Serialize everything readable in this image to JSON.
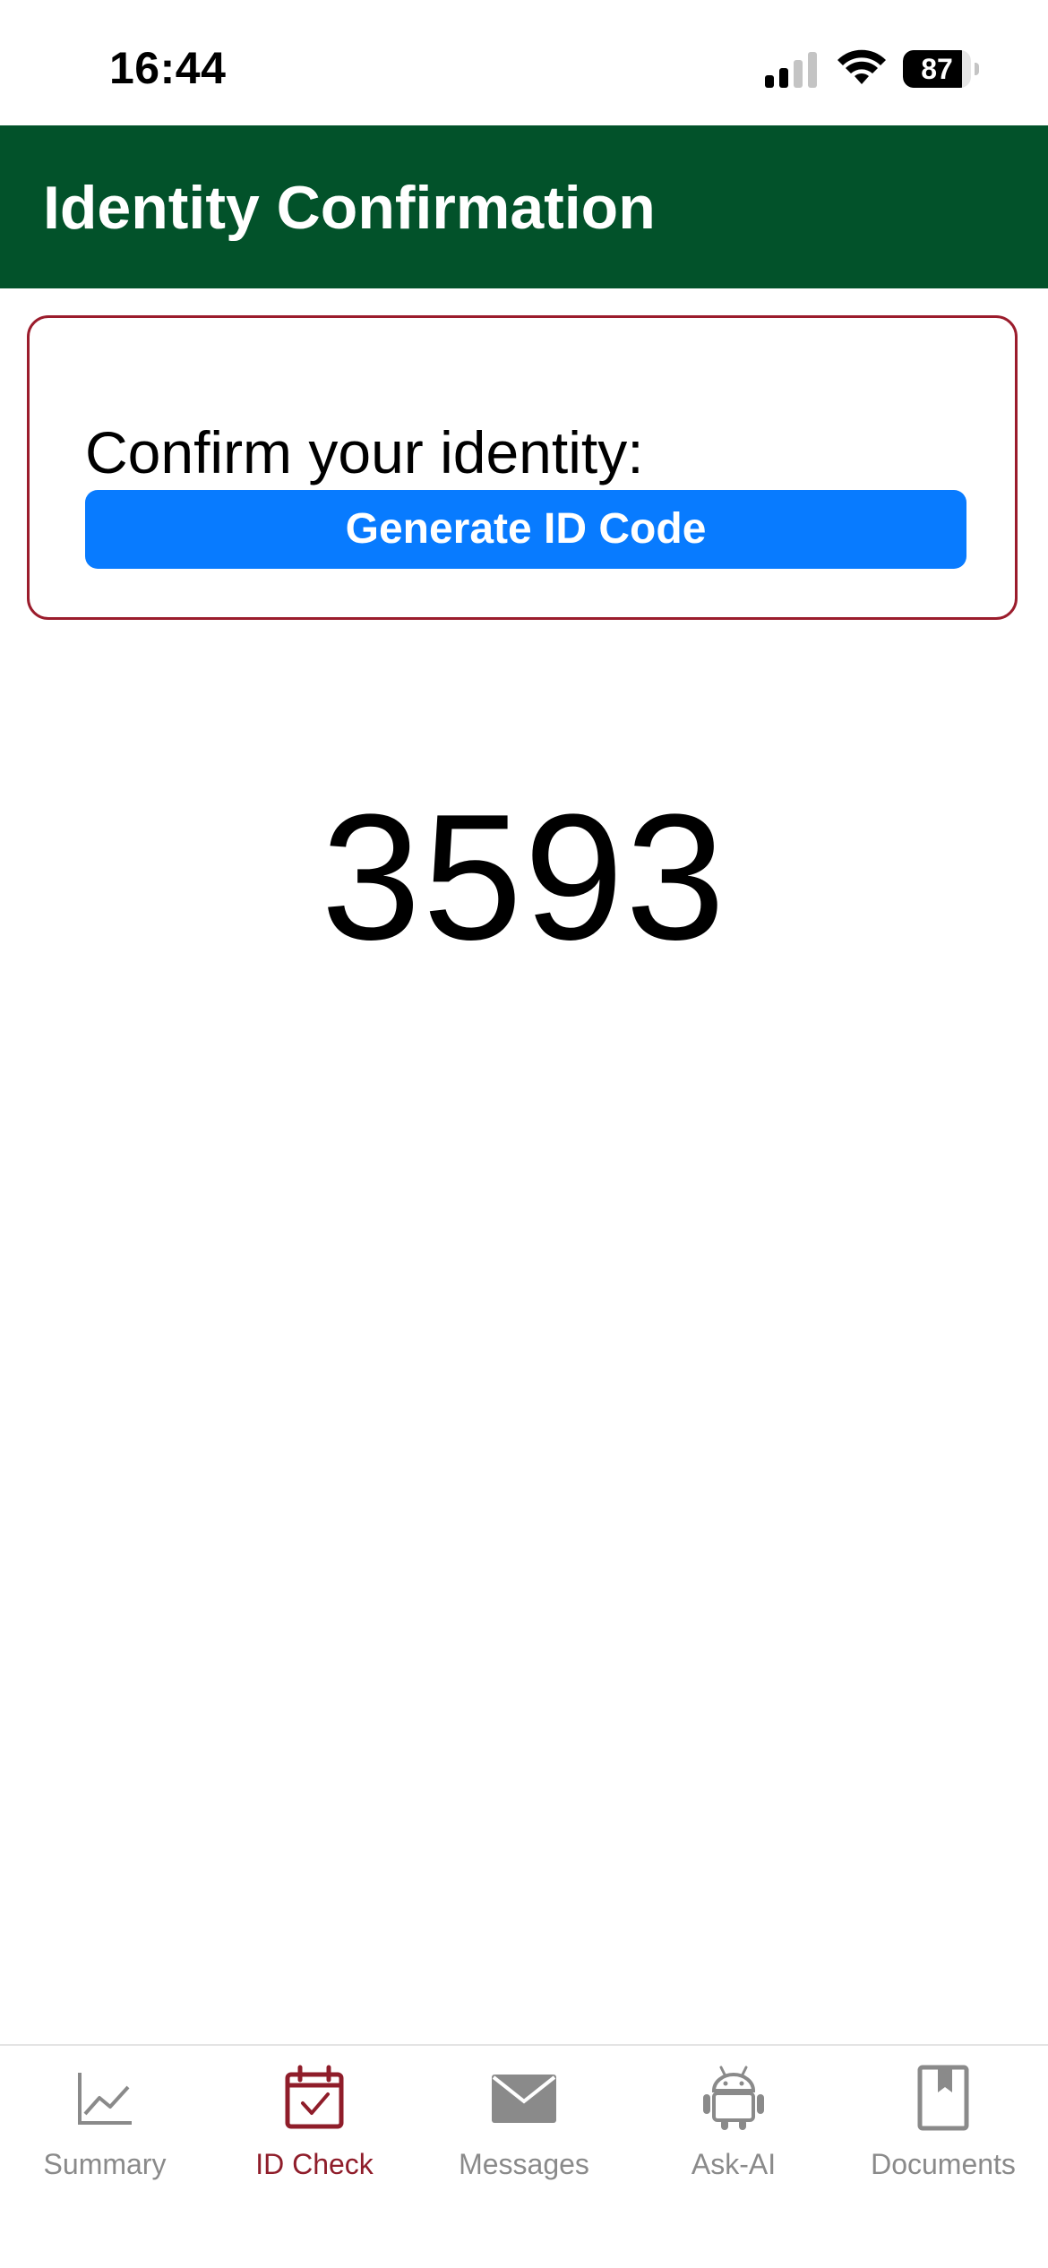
{
  "status_bar": {
    "time": "16:44",
    "battery": "87",
    "battery_level": 0.87
  },
  "header": {
    "title": "Identity Confirmation"
  },
  "card": {
    "prompt": "Confirm your identity:",
    "button_label": "Generate ID Code"
  },
  "id_code": "3593",
  "tabs": [
    {
      "label": "Summary",
      "icon": "chart-line-icon",
      "active": false
    },
    {
      "label": "ID Check",
      "icon": "calendar-check-icon",
      "active": true
    },
    {
      "label": "Messages",
      "icon": "envelope-icon",
      "active": false
    },
    {
      "label": "Ask-AI",
      "icon": "android-robot-icon",
      "active": false
    },
    {
      "label": "Documents",
      "icon": "bookmark-book-icon",
      "active": false
    }
  ],
  "colors": {
    "header_bg": "#02522a",
    "card_border": "#9b1c2c",
    "button_bg": "#087bff",
    "tab_active": "#8f1d2a",
    "tab_inactive": "#8a8a8a"
  }
}
